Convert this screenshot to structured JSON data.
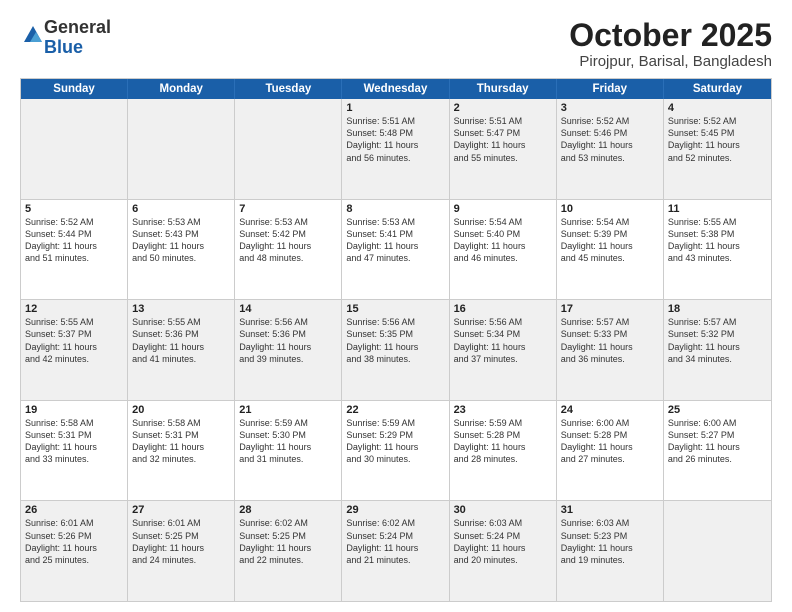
{
  "header": {
    "logo_general": "General",
    "logo_blue": "Blue",
    "month": "October 2025",
    "location": "Pirojpur, Barisal, Bangladesh"
  },
  "weekdays": [
    "Sunday",
    "Monday",
    "Tuesday",
    "Wednesday",
    "Thursday",
    "Friday",
    "Saturday"
  ],
  "rows": [
    [
      {
        "day": "",
        "text": ""
      },
      {
        "day": "",
        "text": ""
      },
      {
        "day": "",
        "text": ""
      },
      {
        "day": "1",
        "text": "Sunrise: 5:51 AM\nSunset: 5:48 PM\nDaylight: 11 hours\nand 56 minutes."
      },
      {
        "day": "2",
        "text": "Sunrise: 5:51 AM\nSunset: 5:47 PM\nDaylight: 11 hours\nand 55 minutes."
      },
      {
        "day": "3",
        "text": "Sunrise: 5:52 AM\nSunset: 5:46 PM\nDaylight: 11 hours\nand 53 minutes."
      },
      {
        "day": "4",
        "text": "Sunrise: 5:52 AM\nSunset: 5:45 PM\nDaylight: 11 hours\nand 52 minutes."
      }
    ],
    [
      {
        "day": "5",
        "text": "Sunrise: 5:52 AM\nSunset: 5:44 PM\nDaylight: 11 hours\nand 51 minutes."
      },
      {
        "day": "6",
        "text": "Sunrise: 5:53 AM\nSunset: 5:43 PM\nDaylight: 11 hours\nand 50 minutes."
      },
      {
        "day": "7",
        "text": "Sunrise: 5:53 AM\nSunset: 5:42 PM\nDaylight: 11 hours\nand 48 minutes."
      },
      {
        "day": "8",
        "text": "Sunrise: 5:53 AM\nSunset: 5:41 PM\nDaylight: 11 hours\nand 47 minutes."
      },
      {
        "day": "9",
        "text": "Sunrise: 5:54 AM\nSunset: 5:40 PM\nDaylight: 11 hours\nand 46 minutes."
      },
      {
        "day": "10",
        "text": "Sunrise: 5:54 AM\nSunset: 5:39 PM\nDaylight: 11 hours\nand 45 minutes."
      },
      {
        "day": "11",
        "text": "Sunrise: 5:55 AM\nSunset: 5:38 PM\nDaylight: 11 hours\nand 43 minutes."
      }
    ],
    [
      {
        "day": "12",
        "text": "Sunrise: 5:55 AM\nSunset: 5:37 PM\nDaylight: 11 hours\nand 42 minutes."
      },
      {
        "day": "13",
        "text": "Sunrise: 5:55 AM\nSunset: 5:36 PM\nDaylight: 11 hours\nand 41 minutes."
      },
      {
        "day": "14",
        "text": "Sunrise: 5:56 AM\nSunset: 5:36 PM\nDaylight: 11 hours\nand 39 minutes."
      },
      {
        "day": "15",
        "text": "Sunrise: 5:56 AM\nSunset: 5:35 PM\nDaylight: 11 hours\nand 38 minutes."
      },
      {
        "day": "16",
        "text": "Sunrise: 5:56 AM\nSunset: 5:34 PM\nDaylight: 11 hours\nand 37 minutes."
      },
      {
        "day": "17",
        "text": "Sunrise: 5:57 AM\nSunset: 5:33 PM\nDaylight: 11 hours\nand 36 minutes."
      },
      {
        "day": "18",
        "text": "Sunrise: 5:57 AM\nSunset: 5:32 PM\nDaylight: 11 hours\nand 34 minutes."
      }
    ],
    [
      {
        "day": "19",
        "text": "Sunrise: 5:58 AM\nSunset: 5:31 PM\nDaylight: 11 hours\nand 33 minutes."
      },
      {
        "day": "20",
        "text": "Sunrise: 5:58 AM\nSunset: 5:31 PM\nDaylight: 11 hours\nand 32 minutes."
      },
      {
        "day": "21",
        "text": "Sunrise: 5:59 AM\nSunset: 5:30 PM\nDaylight: 11 hours\nand 31 minutes."
      },
      {
        "day": "22",
        "text": "Sunrise: 5:59 AM\nSunset: 5:29 PM\nDaylight: 11 hours\nand 30 minutes."
      },
      {
        "day": "23",
        "text": "Sunrise: 5:59 AM\nSunset: 5:28 PM\nDaylight: 11 hours\nand 28 minutes."
      },
      {
        "day": "24",
        "text": "Sunrise: 6:00 AM\nSunset: 5:28 PM\nDaylight: 11 hours\nand 27 minutes."
      },
      {
        "day": "25",
        "text": "Sunrise: 6:00 AM\nSunset: 5:27 PM\nDaylight: 11 hours\nand 26 minutes."
      }
    ],
    [
      {
        "day": "26",
        "text": "Sunrise: 6:01 AM\nSunset: 5:26 PM\nDaylight: 11 hours\nand 25 minutes."
      },
      {
        "day": "27",
        "text": "Sunrise: 6:01 AM\nSunset: 5:25 PM\nDaylight: 11 hours\nand 24 minutes."
      },
      {
        "day": "28",
        "text": "Sunrise: 6:02 AM\nSunset: 5:25 PM\nDaylight: 11 hours\nand 22 minutes."
      },
      {
        "day": "29",
        "text": "Sunrise: 6:02 AM\nSunset: 5:24 PM\nDaylight: 11 hours\nand 21 minutes."
      },
      {
        "day": "30",
        "text": "Sunrise: 6:03 AM\nSunset: 5:24 PM\nDaylight: 11 hours\nand 20 minutes."
      },
      {
        "day": "31",
        "text": "Sunrise: 6:03 AM\nSunset: 5:23 PM\nDaylight: 11 hours\nand 19 minutes."
      },
      {
        "day": "",
        "text": ""
      }
    ]
  ]
}
